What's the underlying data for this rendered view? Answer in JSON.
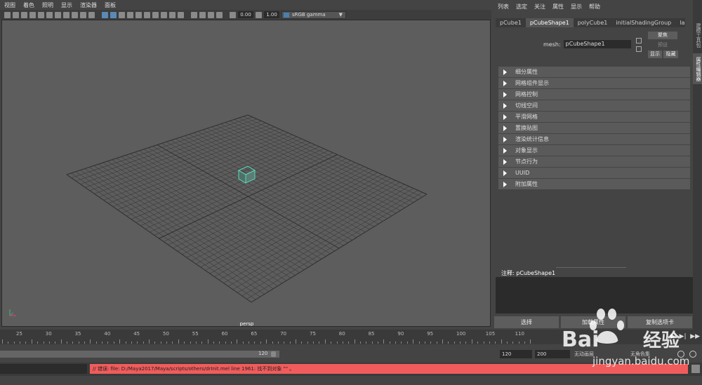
{
  "viewport": {
    "menu": [
      "视图",
      "着色",
      "照明",
      "显示",
      "渲染器",
      "面板"
    ],
    "gamma_low": "0.00",
    "gamma_high": "1.00",
    "color_space": "sRGB gamma",
    "camera_label": "persp"
  },
  "attribute_editor": {
    "menu": [
      "列表",
      "选定",
      "关注",
      "属性",
      "显示",
      "帮助"
    ],
    "tabs": [
      "pCube1",
      "pCubeShape1",
      "polyCube1",
      "initialShadingGroup",
      "la"
    ],
    "active_tab": "pCubeShape1",
    "mesh_label": "mesh:",
    "mesh_value": "pCubeShape1",
    "btn_focus": "聚焦",
    "btn_preset": "预设",
    "btn_show": "显示",
    "btn_hide": "隐藏",
    "sections": [
      "细分属性",
      "网格组件显示",
      "网格控制",
      "切线空间",
      "平滑网格",
      "置换贴图",
      "渲染统计信息",
      "对象显示",
      "节点行为",
      "UUID",
      "附加属性"
    ],
    "notes_label": "注释:  pCubeShape1",
    "bottom": {
      "select": "选择",
      "load": "加载属性",
      "copy": "复制选项卡"
    }
  },
  "side_tabs": [
    "建模工具包",
    "属性编辑器"
  ],
  "timeline": {
    "ticks": [
      "25",
      "30",
      "35",
      "40",
      "45",
      "50",
      "55",
      "60",
      "65",
      "70",
      "75",
      "80",
      "85",
      "90",
      "95",
      "100",
      "105",
      "110"
    ],
    "range_end": "120",
    "start_field": "120",
    "end_field": "200",
    "anim_layer": "无动画层",
    "character_set": "无角色集"
  },
  "command": {
    "error": "// 错误: file: D:/Maya2017/Maya/scripts/others/drInit.mel line 1961: 找不到对象 \"\" 。"
  },
  "watermark": {
    "brand": "Bai",
    "brand2": "经验",
    "url": "jingyan.baidu.com"
  },
  "colors": {
    "error_bg": "#f05c5c",
    "cube": "#5ad6b8",
    "active_icon": "#5a8ab5"
  }
}
